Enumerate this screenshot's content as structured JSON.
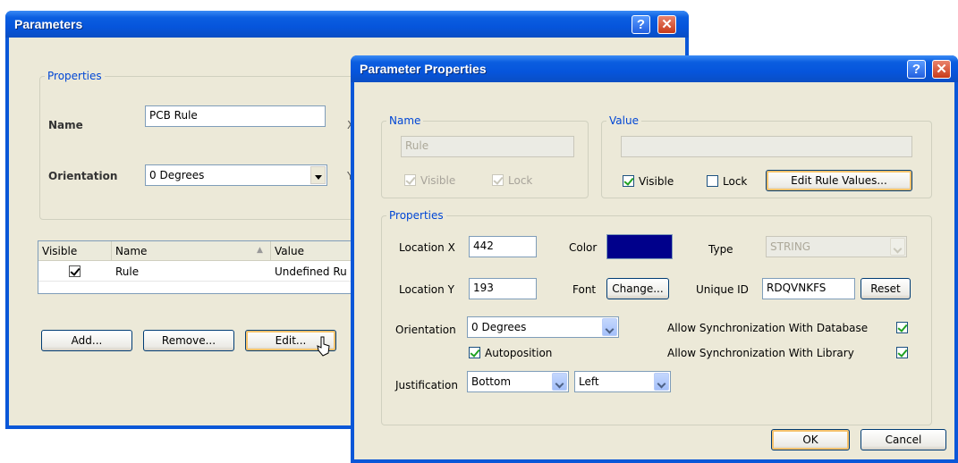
{
  "parameters_dialog": {
    "title": "Parameters",
    "properties_legend": "Properties",
    "name_label": "Name",
    "name_value": "PCB Rule",
    "orientation_label": "Orientation",
    "orientation_value": "0 Degrees",
    "cut_label_x": "X",
    "cut_label_y": "Y",
    "grid": {
      "columns": [
        "Visible",
        "Name",
        "Value"
      ],
      "rows": [
        {
          "visible": true,
          "name": "Rule",
          "value": "Undefined Ru"
        }
      ]
    },
    "buttons": {
      "add": "Add...",
      "remove": "Remove...",
      "edit": "Edit..."
    }
  },
  "param_props_dialog": {
    "title": "Parameter Properties",
    "name_group": {
      "legend": "Name",
      "value": "Rule",
      "visible_label": "Visible",
      "lock_label": "Lock",
      "visible_checked": true,
      "lock_checked": true
    },
    "value_group": {
      "legend": "Value",
      "value": "",
      "visible_label": "Visible",
      "lock_label": "Lock",
      "visible_checked": true,
      "lock_checked": false,
      "edit_rule_values_label": "Edit Rule Values..."
    },
    "properties_group": {
      "legend": "Properties",
      "location_x_label": "Location X",
      "location_x_value": "442",
      "location_y_label": "Location Y",
      "location_y_value": "193",
      "color_label": "Color",
      "color_value": "#00008b",
      "font_label": "Font",
      "change_button": "Change...",
      "type_label": "Type",
      "type_value": "STRING",
      "unique_id_label": "Unique ID",
      "unique_id_value": "RDQVNKFS",
      "reset_button": "Reset",
      "orientation_label": "Orientation",
      "orientation_value": "0 Degrees",
      "autoposition_label": "Autoposition",
      "autoposition_checked": true,
      "sync_database_label": "Allow Synchronization With Database",
      "sync_database_checked": true,
      "sync_library_label": "Allow Synchronization With Library",
      "sync_library_checked": true,
      "justification_label": "Justification",
      "justification_v": "Bottom",
      "justification_h": "Left"
    },
    "ok_button": "OK",
    "cancel_button": "Cancel"
  }
}
